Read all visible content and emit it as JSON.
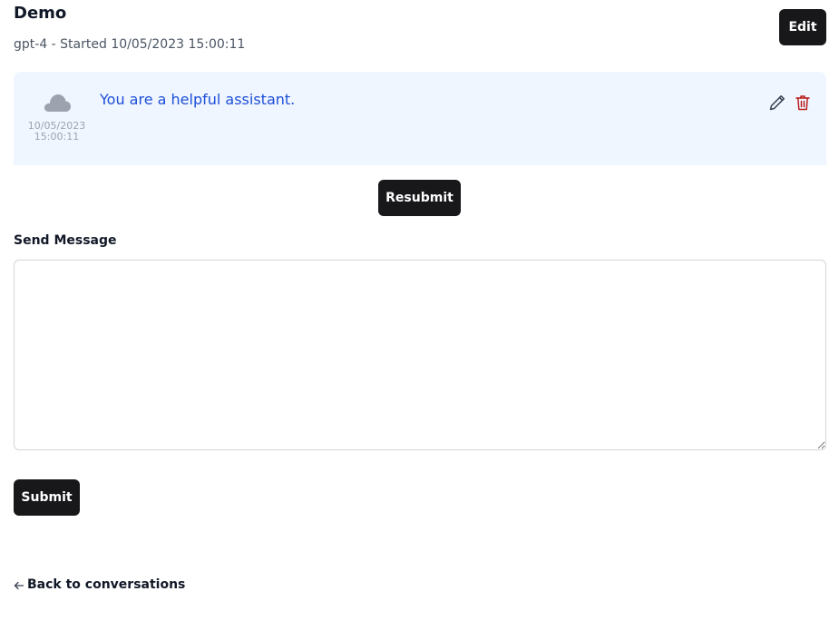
{
  "header": {
    "title": "Demo",
    "subtitle": "gpt-4 - Started 10/05/2023 15:00:11",
    "edit_label": "Edit"
  },
  "messages": [
    {
      "role_icon": "cloud-icon",
      "date": "10/05/2023",
      "time": "15:00:11",
      "text": "You are a helpful assistant.",
      "actions": [
        "pencil-icon",
        "trash-icon"
      ]
    }
  ],
  "resubmit_label": "Resubmit",
  "composer": {
    "label": "Send Message",
    "value": "",
    "placeholder": "",
    "submit_label": "Submit"
  },
  "footer": {
    "back_label": "Back to conversations"
  },
  "colors": {
    "button_bg": "#18181b",
    "message_bg": "#eff6ff",
    "message_text": "#1d4ed8",
    "delete_icon": "#b91c1c"
  }
}
